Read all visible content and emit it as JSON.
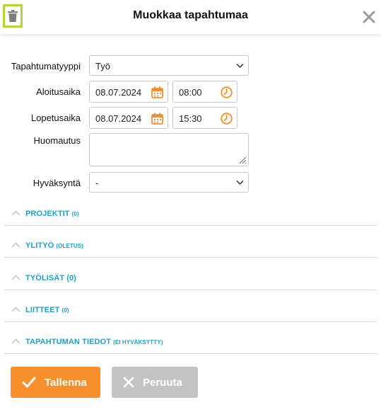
{
  "header": {
    "title": "Muokkaa tapahtumaa"
  },
  "form": {
    "event_type": {
      "label": "Tapahtumatyyppi",
      "value": "Työ"
    },
    "start": {
      "label": "Aloitusaika",
      "date": "08.07.2024",
      "time": "08:00"
    },
    "end": {
      "label": "Lopetusaika",
      "date": "08.07.2024",
      "time": "15:30"
    },
    "note": {
      "label": "Huomautus",
      "value": ""
    },
    "approval": {
      "label": "Hyväksyntä",
      "value": "-"
    }
  },
  "sections": [
    {
      "title": "PROJEKTIT",
      "sub": "(0)"
    },
    {
      "title": "YLITYÖ",
      "sub": "(OLETUS)"
    },
    {
      "title": "TYÖLISÄT",
      "sub": "(0)"
    },
    {
      "title": "LIITTEET",
      "sub": "(0)"
    },
    {
      "title": "TAPAHTUMAN TIEDOT",
      "sub": "(EI HYVÄKSYTTY)"
    }
  ],
  "buttons": {
    "save_label": "Tallenna",
    "cancel_label": "Peruuta"
  },
  "colors": {
    "accent": "#f7902c",
    "section_title": "#1aa3c9",
    "cancel": "#c4c4c4",
    "highlight": "#b6d33a"
  }
}
